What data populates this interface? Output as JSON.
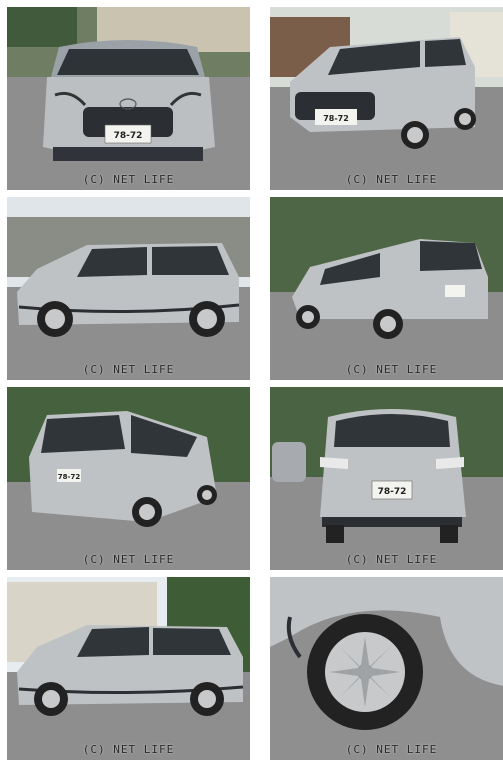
{
  "watermark": "(C) NET LIFE",
  "plate_number": "78-72",
  "photos": [
    {
      "label": "front"
    },
    {
      "label": "front-right three-quarter"
    },
    {
      "label": "left side"
    },
    {
      "label": "rear-left three-quarter"
    },
    {
      "label": "rear-left three-quarter"
    },
    {
      "label": "rear"
    },
    {
      "label": "left side"
    },
    {
      "label": "front wheel close-up"
    }
  ],
  "colors": {
    "body": "#b9bcbf",
    "sky": "#dfe6ea",
    "ground": "#8f8f8f",
    "trees": "#3f5a36",
    "trim": "#2b2f33"
  }
}
